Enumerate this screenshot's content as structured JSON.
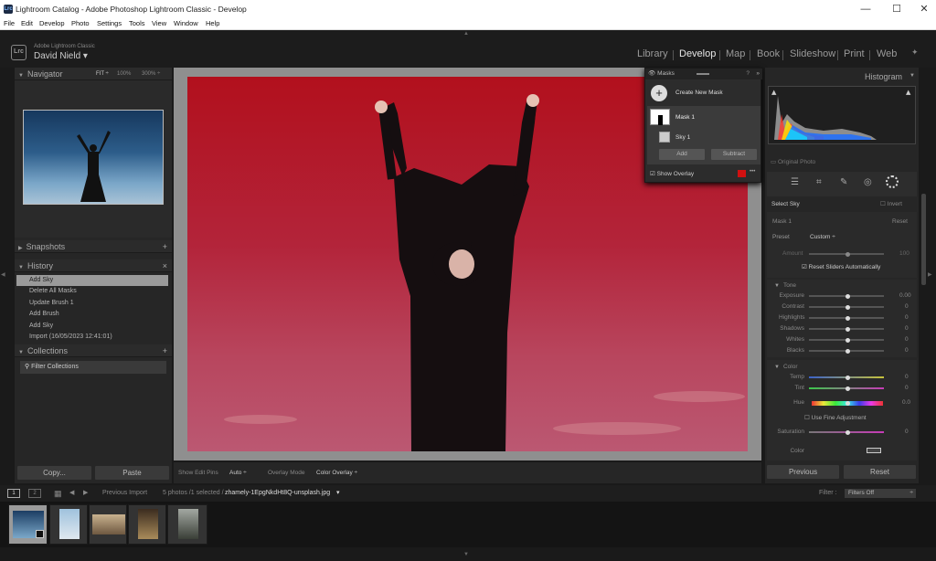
{
  "window": {
    "title": "Lightroom Catalog - Adobe Photoshop Lightroom Classic - Develop",
    "app_icon": "Lrc",
    "minimize": "—",
    "maximize": "☐",
    "close": "✕"
  },
  "menu": [
    "File",
    "Edit",
    "Develop",
    "Photo",
    "Settings",
    "Tools",
    "View",
    "Window",
    "Help"
  ],
  "identity": {
    "logo": "Lrc",
    "product": "Adobe Lightroom Classic",
    "user": "David Nield",
    "user_caret": "▾"
  },
  "modules": [
    "Library",
    "Develop",
    "Map",
    "Book",
    "Slideshow",
    "Print",
    "Web"
  ],
  "active_module": "Develop",
  "left": {
    "navigator": {
      "title": "Navigator",
      "fit": "FIT ÷",
      "z1": "100%",
      "z2": "300% ÷"
    },
    "snapshots": {
      "title": "Snapshots",
      "add": "+"
    },
    "history": {
      "title": "History",
      "clear": "×",
      "items": [
        "Add Sky",
        "Delete All Masks",
        "Update Brush 1",
        "Add Brush",
        "Add Sky",
        "Import (16/05/2023 12:41:01)"
      ]
    },
    "collections": {
      "title": "Collections",
      "add": "+",
      "filter": "Filter Collections"
    },
    "copy": "Copy...",
    "paste": "Paste"
  },
  "toolbar": {
    "show_edit_pins": "Show Edit Pins",
    "edit_pins_value": "Auto ÷",
    "overlay_mode": "Overlay Mode",
    "overlay_value": "Color Overlay ÷"
  },
  "masks": {
    "title": "Masks",
    "create": "Create New Mask",
    "mask1": "Mask 1",
    "sky1": "Sky 1",
    "add": "Add",
    "subtract": "Subtract",
    "show_overlay": "Show Overlay",
    "overlay_color": "#d01010",
    "more": "•••"
  },
  "right": {
    "histogram": {
      "title": "Histogram",
      "original": "Original Photo"
    },
    "select_sky": "Select Sky",
    "invert": "Invert",
    "mask_name": "Mask 1",
    "reset": "Reset",
    "preset_label": "Preset",
    "preset_value": "Custom ÷",
    "amount_label": "Amount",
    "amount_value": "100",
    "reset_sliders": "Reset Sliders Automatically",
    "tone": {
      "title": "Tone",
      "rows": [
        {
          "label": "Exposure",
          "value": "0.00"
        },
        {
          "label": "Contrast",
          "value": "0"
        },
        {
          "label": "Highlights",
          "value": "0"
        },
        {
          "label": "Shadows",
          "value": "0"
        },
        {
          "label": "Whites",
          "value": "0"
        },
        {
          "label": "Blacks",
          "value": "0"
        }
      ]
    },
    "color": {
      "title": "Color",
      "temp": "Temp",
      "tint": "Tint",
      "temp_value": "0",
      "tint_value": "0",
      "hue": "Hue",
      "hue_value": "0.0",
      "fine": "Use Fine Adjustment",
      "saturation": "Saturation",
      "sat_value": "0",
      "color_label": "Color"
    },
    "previous": "Previous",
    "reset_btn": "Reset"
  },
  "filmbar": {
    "previous_import": "Previous Import",
    "count": "5 photos /1 selected /",
    "filename": "zhamely-1EpgNkdHt8Q-unsplash.jpg",
    "filename_caret": "▾",
    "filter_label": "Filter :",
    "filter_value": "Filters Off"
  },
  "colors": {
    "accent": "#e6e6e6",
    "mask_overlay": "#b11a2a"
  }
}
